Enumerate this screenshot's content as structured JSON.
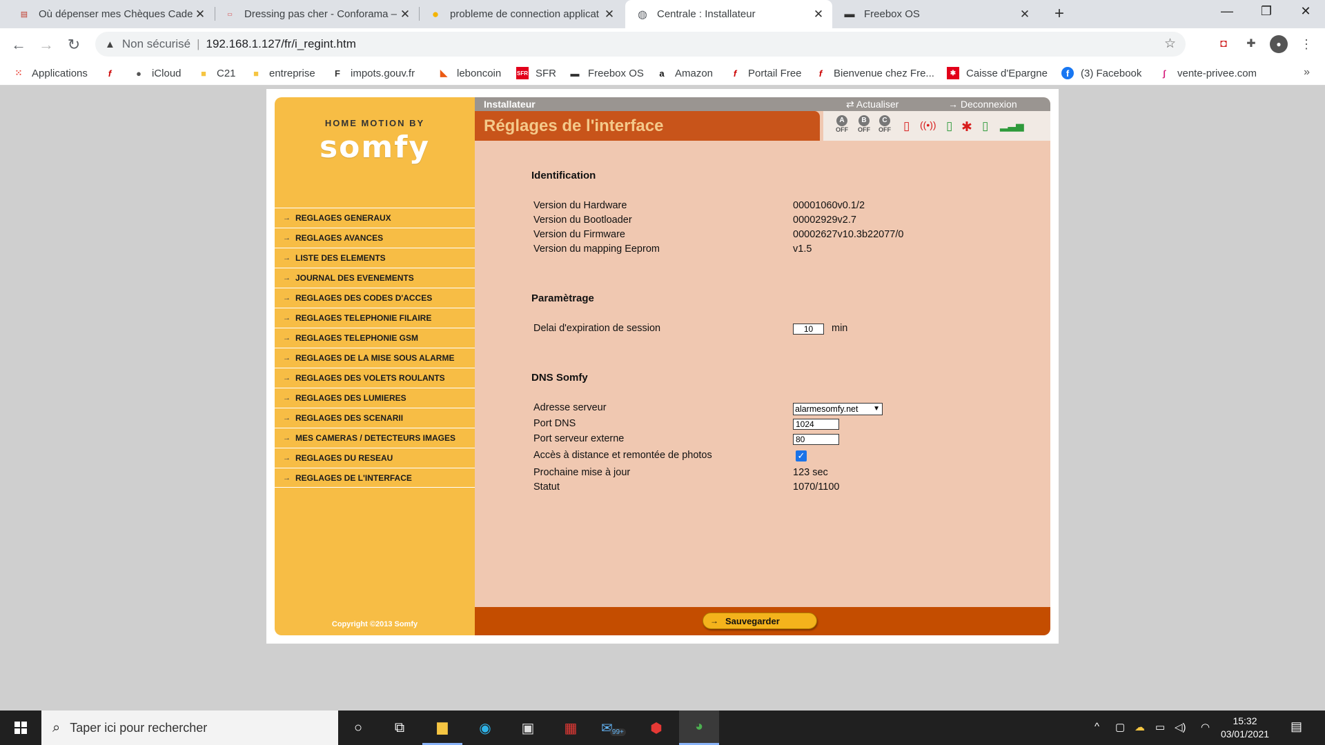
{
  "browser": {
    "tabs": [
      {
        "title": "Où dépenser mes Chèques Cadea",
        "active": false
      },
      {
        "title": "Dressing pas cher - Conforama –",
        "active": false
      },
      {
        "title": "probleme de connection applicat",
        "active": false
      },
      {
        "title": "Centrale  : Installateur",
        "active": true
      },
      {
        "title": "Freebox OS",
        "active": false
      }
    ],
    "address": {
      "security": "Non sécurisé",
      "url": "192.168.1.127/fr/i_regint.htm"
    },
    "bookmarks": [
      "Applications",
      "iCloud",
      "C21",
      "entreprise",
      "impots.gouv.fr",
      "leboncoin",
      "SFR",
      "Freebox OS",
      "Amazon",
      "Portail Free",
      "Bienvenue chez Fre...",
      "Caisse d'Epargne",
      "(3) Facebook",
      "vente-privee.com"
    ]
  },
  "sidebar": {
    "brand_by": "HOME MOTION BY",
    "brand_name": "somfy",
    "menu": [
      "REGLAGES GENERAUX",
      "REGLAGES AVANCES",
      "LISTE DES ELEMENTS",
      "JOURNAL DES EVENEMENTS",
      "REGLAGES DES CODES D'ACCES",
      "REGLAGES TELEPHONIE FILAIRE",
      "REGLAGES TELEPHONIE GSM",
      "REGLAGES DE LA MISE SOUS ALARME",
      "REGLAGES DES VOLETS ROULANTS",
      "REGLAGES DES LUMIERES",
      "REGLAGES DES SCENARII",
      "MES CAMERAS / DETECTEURS IMAGES",
      "REGLAGES DU RESEAU",
      "REGLAGES DE L'INTERFACE"
    ],
    "copyright": "Copyright ©2013 Somfy"
  },
  "topbar": {
    "role": "Installateur",
    "refresh": "Actualiser",
    "logout": "Deconnexion"
  },
  "header": {
    "title": "Réglages de l'interface",
    "zones": [
      {
        "letter": "A",
        "state": "OFF"
      },
      {
        "letter": "B",
        "state": "OFF"
      },
      {
        "letter": "C",
        "state": "OFF"
      }
    ]
  },
  "identification": {
    "heading": "Identification",
    "rows": [
      {
        "label": "Version du Hardware",
        "value": "00001060v0.1/2"
      },
      {
        "label": "Version du Bootloader",
        "value": "00002929v2.7"
      },
      {
        "label": "Version du Firmware",
        "value": "00002627v10.3b22077/0"
      },
      {
        "label": "Version du mapping Eeprom",
        "value": "v1.5"
      }
    ]
  },
  "parametrage": {
    "heading": "Paramètrage",
    "session_label": "Delai d'expiration de session",
    "session_value": "10",
    "session_unit": "min"
  },
  "dns": {
    "heading": "DNS Somfy",
    "server_label": "Adresse serveur",
    "server_value": "alarmesomfy.net",
    "port_label": "Port DNS",
    "port_value": "1024",
    "ext_port_label": "Port serveur externe",
    "ext_port_value": "80",
    "remote_label": "Accès à distance et remontée de photos",
    "remote_checked": true,
    "next_update_label": "Prochaine mise à jour",
    "next_update_value": "123 sec",
    "status_label": "Statut",
    "status_value": "1070/1100"
  },
  "footer": {
    "save": "Sauvegarder"
  },
  "taskbar": {
    "search_placeholder": "Taper ici pour rechercher",
    "mail_badge": "99+",
    "time": "15:32",
    "date": "03/01/2021"
  }
}
